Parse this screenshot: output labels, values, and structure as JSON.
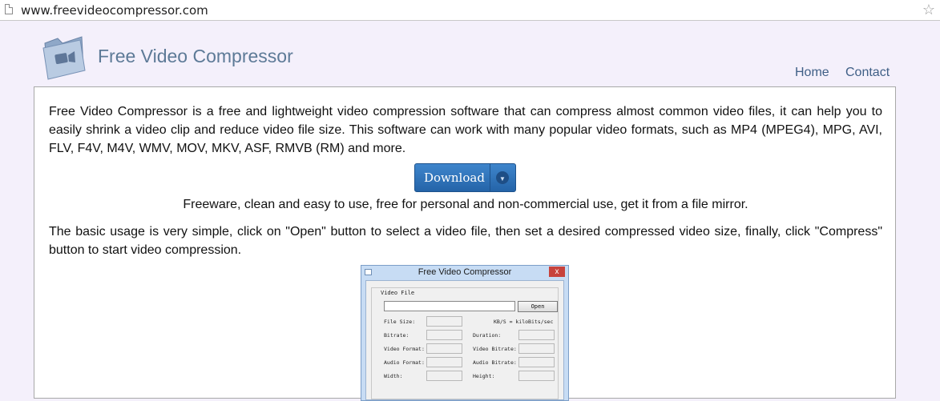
{
  "browser": {
    "url": "www.freevideocompressor.com"
  },
  "site": {
    "title": "Free Video Compressor",
    "nav": {
      "home": "Home",
      "contact": "Contact"
    }
  },
  "content": {
    "intro": "Free Video Compressor is a free and lightweight video compression software that can compress almost common video files, it can help you to easily shrink a video clip and reduce video file size. This software can work with many popular video formats, such as MP4 (MPEG4), MPG, AVI, FLV, F4V, M4V, WMV, MOV, MKV, ASF, RMVB (RM) and more.",
    "download_label": "Download",
    "freeware_note": "Freeware, clean and easy to use, free for personal and non-commercial use, get it from a file mirror.",
    "usage": "The basic usage is very simple, click on \"Open\" button to select a video file, then set a desired compressed video size, finally, click \"Compress\" button to start video compression."
  },
  "app_window": {
    "title": "Free Video Compressor",
    "close": "x",
    "group_label": "Video File",
    "open_button": "Open",
    "kbs_note": "KB/S = kiloBits/sec",
    "fields": {
      "file_size": "File Size:",
      "bitrate": "Bitrate:",
      "duration": "Duration:",
      "video_format": "Video Format:",
      "video_bitrate": "Video Bitrate:",
      "audio_format": "Audio Format:",
      "audio_bitrate": "Audio Bitrate:",
      "width": "Width:",
      "height": "Height:"
    }
  },
  "colors": {
    "title": "#5d7a97",
    "nav": "#3f5f86",
    "button": "#2f74bb",
    "page_bg": "#f4f0fb"
  },
  "icons": {
    "page": "page-icon",
    "bookmark": "star-icon",
    "logo": "video-folder-icon",
    "dropdown": "chevron-down-icon"
  }
}
